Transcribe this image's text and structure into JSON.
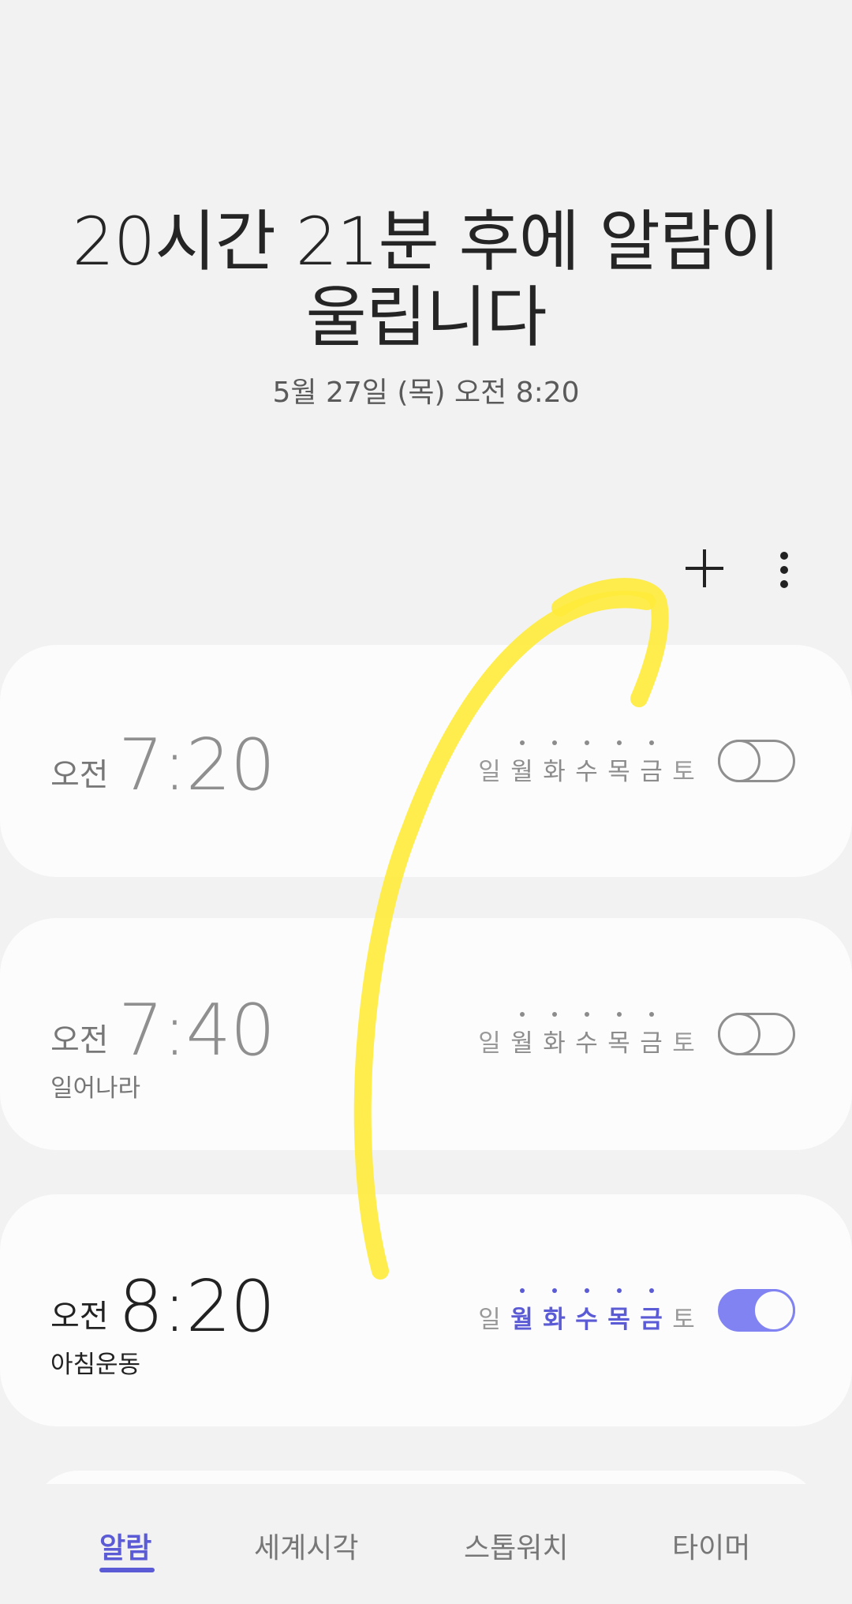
{
  "header": {
    "title_line1": "20시간 21분 후에 알람이",
    "title_line2": "울립니다",
    "subtitle": "5월 27일 (목) 오전 8:20"
  },
  "toolbar": {
    "add_icon": "plus-icon",
    "more_icon": "more-vertical-icon"
  },
  "alarms": [
    {
      "ampm": "오전",
      "time": "7:20",
      "label": "",
      "days": [
        "일",
        "월",
        "화",
        "수",
        "목",
        "금",
        "토"
      ],
      "repeat": [
        false,
        true,
        true,
        true,
        true,
        true,
        false
      ],
      "enabled": false
    },
    {
      "ampm": "오전",
      "time": "7:40",
      "label": "일어나라",
      "days": [
        "일",
        "월",
        "화",
        "수",
        "목",
        "금",
        "토"
      ],
      "repeat": [
        false,
        true,
        true,
        true,
        true,
        true,
        false
      ],
      "enabled": false
    },
    {
      "ampm": "오전",
      "time": "8:20",
      "label": "아침운동",
      "days": [
        "일",
        "월",
        "화",
        "수",
        "목",
        "금",
        "토"
      ],
      "repeat": [
        false,
        true,
        true,
        true,
        true,
        true,
        false
      ],
      "enabled": true
    }
  ],
  "tabs": [
    {
      "label": "알람",
      "selected": true
    },
    {
      "label": "세계시각",
      "selected": false
    },
    {
      "label": "스톱워치",
      "selected": false
    },
    {
      "label": "타이머",
      "selected": false
    }
  ],
  "colors": {
    "accent": "#5b5bd6",
    "toggle_on": "#8183f2",
    "annotation_arrow": "#ffeb3b"
  }
}
